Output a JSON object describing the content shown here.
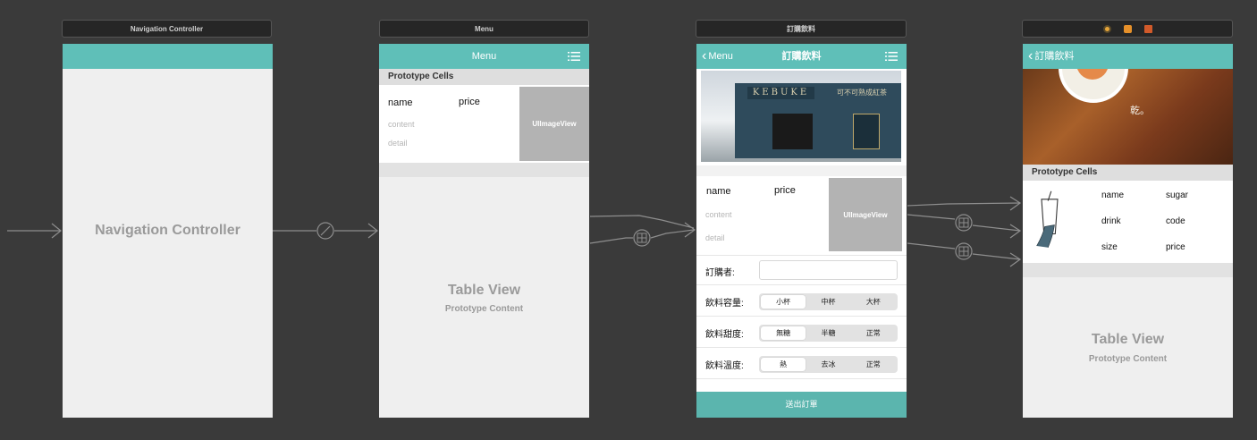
{
  "scenes": {
    "nav": {
      "bar_title": "Navigation Controller",
      "center_label": "Navigation Controller"
    },
    "menu": {
      "bar_title": "Menu",
      "nav_title": "Menu",
      "section": "Prototype Cells",
      "cell": {
        "name": "name",
        "price": "price",
        "content": "content",
        "detail": "detail",
        "image": "UIImageView"
      },
      "table_title": "Table View",
      "table_sub": "Prototype Content"
    },
    "order": {
      "bar_title": "訂購飲料",
      "back": "Menu",
      "nav_title": "訂購飲料",
      "banner_sign": "KEBUKE",
      "banner_sign2": "可不可熟成紅茶",
      "cell": {
        "name": "name",
        "price": "price",
        "content": "content",
        "detail": "detail",
        "image": "UIImageView"
      },
      "orderer_label": "訂購者:",
      "size": {
        "label": "飲料容量:",
        "options": [
          "小杯",
          "中杯",
          "大杯"
        ]
      },
      "sweet": {
        "label": "飲料甜度:",
        "options": [
          "無糖",
          "半糖",
          "正常"
        ]
      },
      "temp": {
        "label": "飲料溫度:",
        "options": [
          "熱",
          "去冰",
          "正常"
        ]
      },
      "submit": "送出訂單"
    },
    "list": {
      "back": "訂購飲料",
      "banner_text": "乾。",
      "section": "Prototype Cells",
      "cell": {
        "name": "name",
        "sugar": "sugar",
        "drink": "drink",
        "code": "code",
        "size": "size",
        "price": "price"
      },
      "table_title": "Table View",
      "table_sub": "Prototype Content"
    }
  },
  "colors": {
    "nav": "#5fbfb8",
    "canvas": "#3a3a3a",
    "segue": "#9a9a9a"
  }
}
